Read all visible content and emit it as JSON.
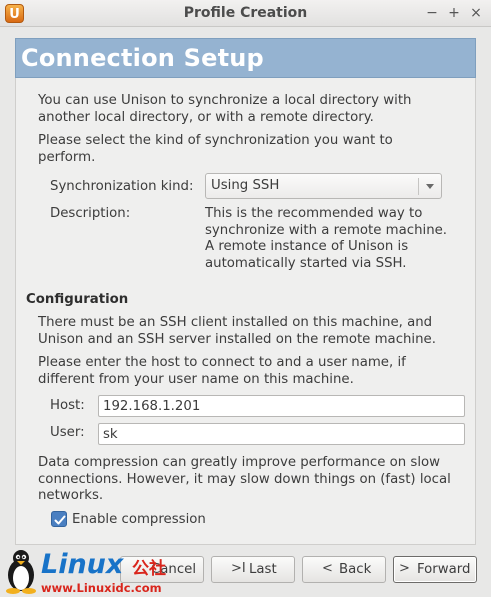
{
  "window": {
    "title": "Profile Creation",
    "app_icon_glyph": "U",
    "controls": {
      "minimize": "−",
      "maximize": "+",
      "close": "×"
    }
  },
  "page": {
    "heading": "Connection Setup",
    "intro_1": "You can use Unison to synchronize a local directory with\nanother local directory, or with a remote directory.",
    "intro_2": "Please select the kind of synchronization you want to\nperform.",
    "sync_kind_label": "Synchronization kind:",
    "sync_kind_value": "Using SSH",
    "description_label": "Description:",
    "description_text": "This is the recommended way to\nsynchronize with a remote machine.\nA remote instance of Unison is\nautomatically started via SSH.",
    "config_heading": "Configuration",
    "config_text_1": "There must be an SSH client installed on this machine, and\nUnison and an SSH server installed on the remote machine.",
    "config_text_2": "Please enter the host to connect to and a user name, if\ndifferent from your user name on this machine.",
    "host_label": "Host:",
    "host_value": "192.168.1.201",
    "user_label": "User:",
    "user_value": "sk",
    "compression_text": "Data compression can greatly improve performance on slow\nconnections.  However, it may slow down things on (fast) local\nnetworks.",
    "compression_checkbox_label": "Enable compression",
    "compression_checked": true
  },
  "buttons": {
    "cancel": "Cancel",
    "last": "Last",
    "back": "Back",
    "forward": "Forward"
  },
  "watermark": {
    "logo_text": "Linux",
    "chinese_text": "公社",
    "url": "www.Linuxidc.com"
  },
  "colors": {
    "header_band": "#95b3d1",
    "accent_checkbox": "#4a7fc1",
    "watermark_blue": "#1873c8",
    "watermark_red": "#d9251c"
  }
}
